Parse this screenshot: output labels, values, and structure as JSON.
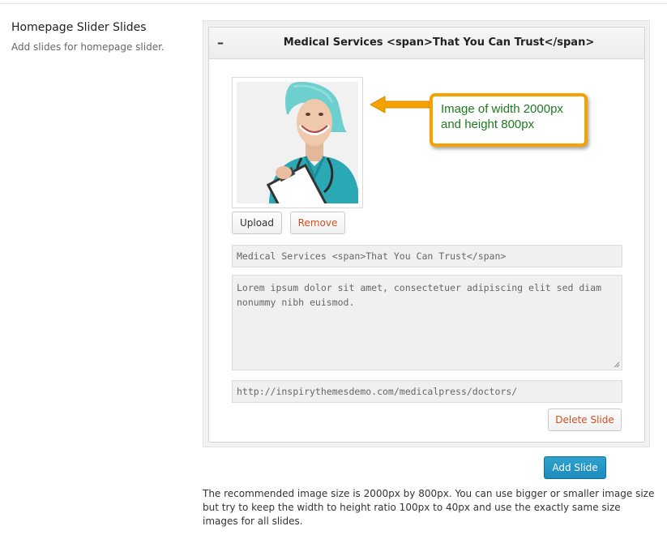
{
  "section": {
    "title": "Homepage Slider Slides",
    "description": "Add slides for homepage slider."
  },
  "slide": {
    "collapse_symbol": "–",
    "header_title": "Medical Services <span>That You Can Trust</span>",
    "image_alt": "Smiling nurse holding a clipboard",
    "upload_label": "Upload",
    "remove_label": "Remove",
    "title_value": "Medical Services <span>That You Can Trust</span>",
    "description_value": "Lorem ipsum dolor sit amet, consectetuer adipiscing elit sed diam nonummy nibh euismod.",
    "url_value": "http://inspirythemesdemo.com/medicalpress/doctors/",
    "delete_label": "Delete Slide"
  },
  "callout": {
    "line1": "Image of width 2000px",
    "line2": "and height 800px"
  },
  "add_slide_label": "Add Slide",
  "note": "The recommended image size is 2000px by 800px. You can use bigger or smaller image size but try to keep the width to height ratio 100px to 40px and use the exactly same size images for all slides.",
  "colors": {
    "accent": "#1e8cbe",
    "remove_text": "#d54e21",
    "callout_border": "#f5a200",
    "callout_text": "#1e7a1e"
  },
  "icons": {
    "collapse": "minus-icon",
    "arrow": "left-arrow-icon",
    "resize": "resize-grip-icon"
  }
}
